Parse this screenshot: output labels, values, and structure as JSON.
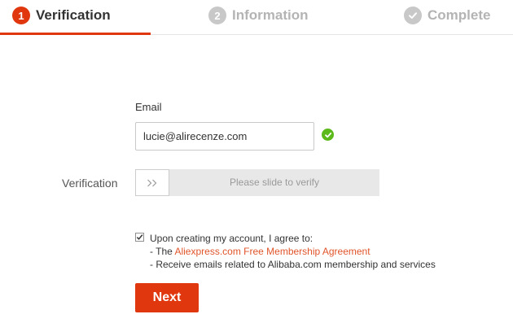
{
  "steps": {
    "items": [
      {
        "number": "1",
        "label": "Verification",
        "state": "active"
      },
      {
        "number": "2",
        "label": "Information",
        "state": "upcoming"
      },
      {
        "icon": "check-icon",
        "label": "Complete",
        "state": "upcoming"
      }
    ]
  },
  "form": {
    "email_label": "Email",
    "email_value": "lucie@alirecenze.com",
    "email_status_icon": "valid-check-icon",
    "verification_label": "Verification",
    "slider_handle_icon": "double-chevron-right-icon",
    "slider_text": "Please slide to verify"
  },
  "agreement": {
    "checked": true,
    "intro": "Upon creating my account, I agree to:",
    "line1_prefix": "- The ",
    "line1_link": "Aliexpress.com Free Membership Agreement",
    "line2": "- Receive emails related to Alibaba.com membership and services"
  },
  "actions": {
    "next_label": "Next"
  },
  "colors": {
    "accent": "#e0370f",
    "link": "#e0552a",
    "success": "#5cb91a",
    "inactive_step": "#b4b4b4"
  }
}
